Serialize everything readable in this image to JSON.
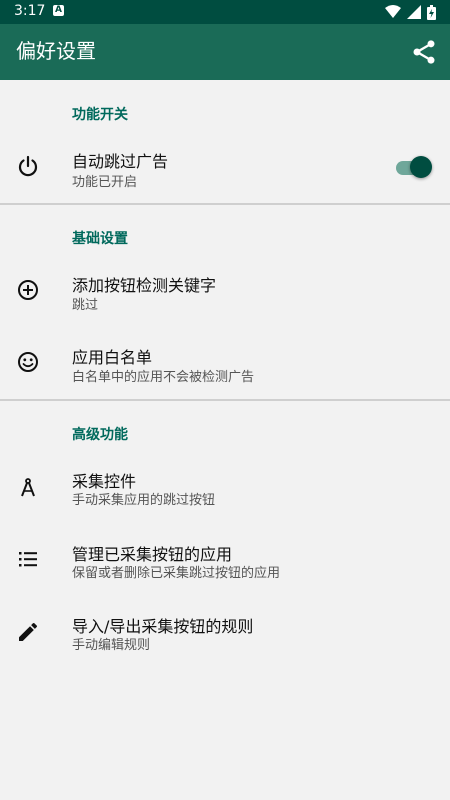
{
  "status_bar": {
    "time": "3:17",
    "notification_icon": "app-notification-icon",
    "wifi_icon": "wifi-icon",
    "signal_icon": "signal-icon",
    "battery_icon": "battery-charging-icon"
  },
  "app_bar": {
    "title": "偏好设置",
    "share_icon": "share-icon"
  },
  "colors": {
    "status_bar": "#004d40",
    "app_bar": "#1a6b57",
    "accent": "#00695c",
    "background": "#f2f2f2"
  },
  "sections": [
    {
      "header": "功能开关",
      "items": [
        {
          "title": "自动跳过广告",
          "subtitle": "功能已开启",
          "icon": "power-icon",
          "toggle_on": true
        }
      ]
    },
    {
      "header": "基础设置",
      "items": [
        {
          "title": "添加按钮检测关键字",
          "subtitle": "跳过",
          "icon": "add-circle-icon"
        },
        {
          "title": "应用白名单",
          "subtitle": "白名单中的应用不会被检测广告",
          "icon": "smiley-icon"
        }
      ]
    },
    {
      "header": "高级功能",
      "items": [
        {
          "title": "采集控件",
          "subtitle": "手动采集应用的跳过按钮",
          "icon": "compass-icon"
        },
        {
          "title": "管理已采集按钮的应用",
          "subtitle": "保留或者删除已采集跳过按钮的应用",
          "icon": "list-icon"
        },
        {
          "title": "导入/导出采集按钮的规则",
          "subtitle": "手动编辑规则",
          "icon": "pencil-icon"
        }
      ]
    }
  ]
}
